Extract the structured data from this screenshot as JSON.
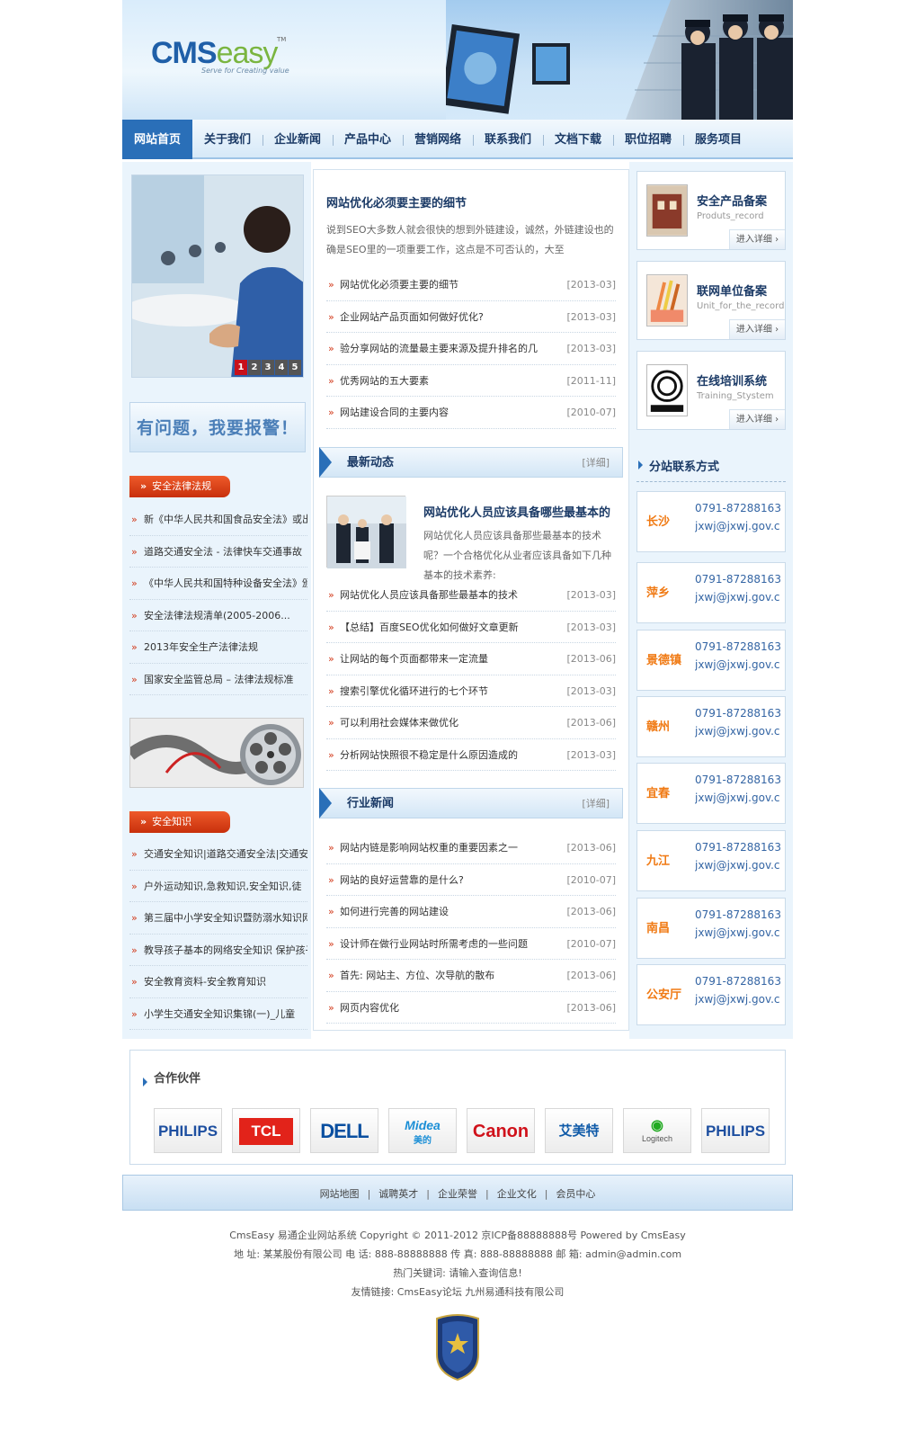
{
  "header": {
    "logo_cms": "CMS",
    "logo_easy": "easy",
    "logo_tm": "TM",
    "logo_slogan": "Serve for Creating value"
  },
  "nav": {
    "items": [
      "网站首页",
      "关于我们",
      "企业新闻",
      "产品中心",
      "营销网络",
      "联系我们",
      "文档下载",
      "职位招聘",
      "服务项目"
    ],
    "active_index": 0
  },
  "left": {
    "slide_dots": [
      "1",
      "2",
      "3",
      "4",
      "5"
    ],
    "report_button": "有问题，我要报警！",
    "law_tag": "安全法律法规",
    "law_items": [
      "新《中华人民共和国食品安全法》或出台",
      "道路交通安全法 - 法律快车交通事故",
      "《中华人民共和国特种设备安全法》颁布",
      "安全法律法规清单(2005-2006...",
      "2013年安全生产法律法规",
      "国家安全监管总局 – 法律法规标准"
    ],
    "knowledge_tag": "安全知识",
    "knowledge_items": [
      "交通安全知识|道路交通安全法|交通安",
      "户外运动知识,急救知识,安全知识,徒",
      "第三届中小学安全知识暨防溺水知识网络",
      "教导孩子基本的网络安全知识 保护孩子",
      "安全教育资料-安全教育知识",
      "小学生交通安全知识集锦(一)_儿童"
    ]
  },
  "center": {
    "headline_title": "网站优化必须要主要的细节",
    "headline_desc": "说到SEO大多数人就会很快的想到外链建设，诚然，外链建设也的确是SEO里的一项重要工作，这点是不可否认的，大至",
    "top_list": [
      {
        "title": "网站优化必须要主要的细节",
        "date": "[2013-03]"
      },
      {
        "title": "企业网站产品页面如何做好优化?",
        "date": "[2013-03]"
      },
      {
        "title": "验分享网站的流量最主要来源及提升排名的几",
        "date": "[2013-03]"
      },
      {
        "title": "优秀网站的五大要素",
        "date": "[2011-11]"
      },
      {
        "title": "网站建设合同的主要内容",
        "date": "[2010-07]"
      }
    ],
    "latest_bar": "最新动态",
    "latest_more": "[详细]",
    "news_title": "网站优化人员应该具备哪些最基本的",
    "news_desc": "网站优化人员应该具备那些最基本的技术呢？一个合格优化从业者应该具备如下几种基本的技术素养:",
    "latest_list": [
      {
        "title": "网站优化人员应该具备那些最基本的技术",
        "date": "[2013-03]"
      },
      {
        "title": "【总结】百度SEO优化如何做好文章更新",
        "date": "[2013-03]"
      },
      {
        "title": "让网站的每个页面都带来一定流量",
        "date": "[2013-06]"
      },
      {
        "title": "搜索引擎优化循环进行的七个环节",
        "date": "[2013-03]"
      },
      {
        "title": "可以利用社会媒体来做优化",
        "date": "[2013-06]"
      },
      {
        "title": "分析网站快照很不稳定是什么原因造成的",
        "date": "[2013-03]"
      }
    ],
    "industry_bar": "行业新闻",
    "industry_more": "[详细]",
    "industry_list": [
      {
        "title": "网站内链是影响网站权重的重要因素之一",
        "date": "[2013-06]"
      },
      {
        "title": "网站的良好运营靠的是什么?",
        "date": "[2010-07]"
      },
      {
        "title": "如何进行完善的网站建设",
        "date": "[2013-06]"
      },
      {
        "title": "设计师在做行业网站时所需考虑的一些问题",
        "date": "[2010-07]"
      },
      {
        "title": "首先: 网站主、方位、次导航的散布",
        "date": "[2013-06]"
      },
      {
        "title": "网页内容优化",
        "date": "[2013-06]"
      }
    ]
  },
  "right": {
    "cards": [
      {
        "title": "安全产品备案",
        "sub": "Produts_record",
        "more": "进入详细"
      },
      {
        "title": "联网单位备案",
        "sub": "Unit_for_the_record",
        "more": "进入详细"
      },
      {
        "title": "在线培训系统",
        "sub": "Training_Stystem",
        "more": "进入详细"
      }
    ],
    "contact_title": "分站联系方式",
    "cities": [
      {
        "name": "长沙",
        "phone": "0791-87288163",
        "email": "jxwj@jxwj.gov.c"
      },
      {
        "name": "萍乡",
        "phone": "0791-87288163",
        "email": "jxwj@jxwj.gov.c"
      },
      {
        "name": "景德镇",
        "phone": "0791-87288163",
        "email": "jxwj@jxwj.gov.c"
      },
      {
        "name": "赣州",
        "phone": "0791-87288163",
        "email": "jxwj@jxwj.gov.c"
      },
      {
        "name": "宜春",
        "phone": "0791-87288163",
        "email": "jxwj@jxwj.gov.c"
      },
      {
        "name": "九江",
        "phone": "0791-87288163",
        "email": "jxwj@jxwj.gov.c"
      },
      {
        "name": "南昌",
        "phone": "0791-87288163",
        "email": "jxwj@jxwj.gov.c"
      },
      {
        "name": "公安厅",
        "phone": "0791-87288163",
        "email": "jxwj@jxwj.gov.c"
      }
    ]
  },
  "partners": {
    "title": "合作伙伴",
    "logos": [
      "PHILIPS",
      "TCL",
      "DELL",
      "Midea",
      "Canon",
      "艾美特",
      "Logitech",
      "PHILIPS"
    ],
    "midea_sub": "美的"
  },
  "footer": {
    "links": [
      "网站地图",
      "诚聘英才",
      "企业荣誉",
      "企业文化",
      "会员中心"
    ],
    "line1": "CmsEasy 易通企业网站系统  Copyright © 2011-2012  京ICP备88888888号  Powered by CmsEasy",
    "line2": "地 址: 某某股份有限公司  电 话: 888-88888888  传 真: 888-88888888  邮 箱: admin@admin.com",
    "line3": "热门关键词:  请输入查询信息!",
    "line4": "友情链接:   CmsEasy论坛  九州易通科技有限公司"
  },
  "colors": {
    "nav_active": "#2a6fb8",
    "accent_orange": "#f07a14",
    "tag_red": "#d2391a",
    "title_blue": "#1b3a66"
  }
}
